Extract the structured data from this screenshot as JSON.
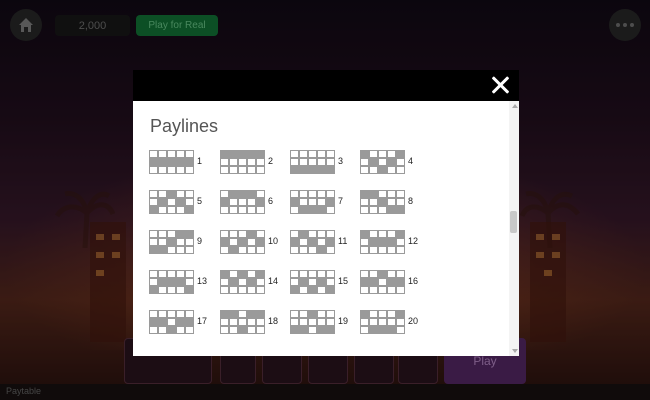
{
  "topbar": {
    "balance": "2,000",
    "play_real_label": "Play for Real"
  },
  "modal": {
    "title": "Paylines"
  },
  "paylines": [
    {
      "num": "1",
      "rows": [
        1,
        1,
        1,
        1,
        1
      ]
    },
    {
      "num": "2",
      "rows": [
        0,
        0,
        0,
        0,
        0
      ]
    },
    {
      "num": "3",
      "rows": [
        2,
        2,
        2,
        2,
        2
      ]
    },
    {
      "num": "4",
      "rows": [
        0,
        1,
        2,
        1,
        0
      ]
    },
    {
      "num": "5",
      "rows": [
        2,
        1,
        0,
        1,
        2
      ]
    },
    {
      "num": "6",
      "rows": [
        1,
        0,
        0,
        0,
        1
      ]
    },
    {
      "num": "7",
      "rows": [
        1,
        2,
        2,
        2,
        1
      ]
    },
    {
      "num": "8",
      "rows": [
        0,
        0,
        1,
        2,
        2
      ]
    },
    {
      "num": "9",
      "rows": [
        2,
        2,
        1,
        0,
        0
      ]
    },
    {
      "num": "10",
      "rows": [
        1,
        2,
        1,
        0,
        1
      ]
    },
    {
      "num": "11",
      "rows": [
        1,
        0,
        1,
        2,
        1
      ]
    },
    {
      "num": "12",
      "rows": [
        0,
        1,
        1,
        1,
        0
      ]
    },
    {
      "num": "13",
      "rows": [
        2,
        1,
        1,
        1,
        2
      ]
    },
    {
      "num": "14",
      "rows": [
        0,
        1,
        0,
        1,
        0
      ]
    },
    {
      "num": "15",
      "rows": [
        2,
        1,
        2,
        1,
        2
      ]
    },
    {
      "num": "16",
      "rows": [
        1,
        1,
        0,
        1,
        1
      ]
    },
    {
      "num": "17",
      "rows": [
        1,
        1,
        2,
        1,
        1
      ]
    },
    {
      "num": "18",
      "rows": [
        0,
        0,
        2,
        0,
        0
      ]
    },
    {
      "num": "19",
      "rows": [
        2,
        2,
        0,
        2,
        2
      ]
    },
    {
      "num": "20",
      "rows": [
        0,
        2,
        2,
        2,
        0
      ]
    }
  ],
  "bottom": {
    "play_label": "Play",
    "status": "Paytable"
  },
  "colors": {
    "header": "#000000",
    "payline_fill": "#9a9a9a",
    "play_real_green": "#137a3a"
  }
}
